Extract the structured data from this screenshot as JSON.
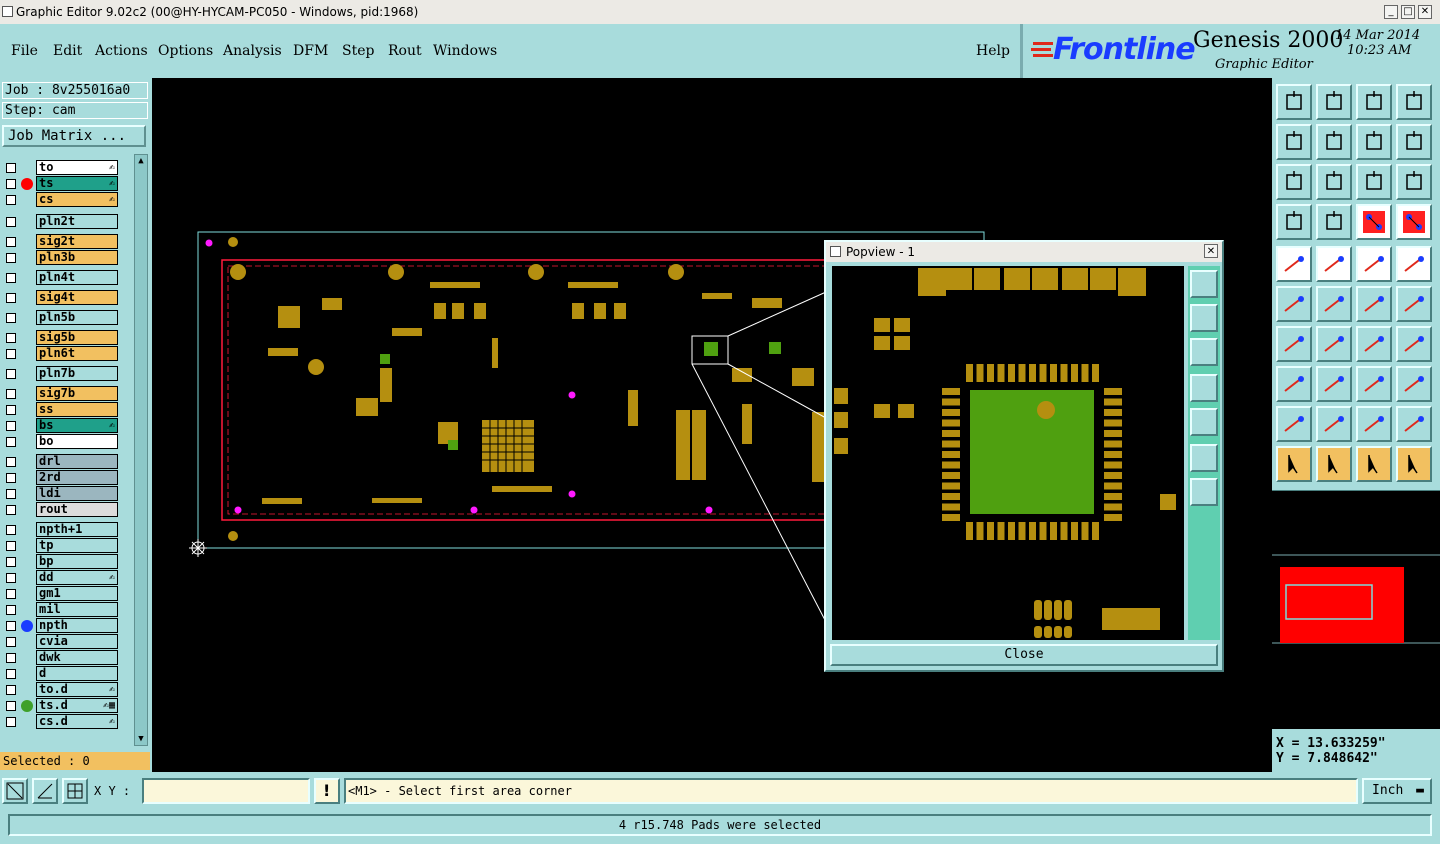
{
  "window": {
    "title": "Graphic Editor 9.02c2 (00@HY-HYCAM-PC050 - Windows, pid:1968)",
    "min_label": "_",
    "max_label": "□",
    "close_label": "✕"
  },
  "menu": {
    "items": [
      "File",
      "Edit",
      "Actions",
      "Options",
      "Analysis",
      "DFM",
      "Step",
      "Rout",
      "Windows"
    ],
    "help": "Help"
  },
  "logo": {
    "brand": "Frontline",
    "product": "Genesis 2000",
    "subtitle": "Graphic Editor",
    "date": "14 Mar 2014",
    "time": "10:23 AM"
  },
  "job": {
    "job_label": "Job : 8v255016a0",
    "step_label": "Step: cam",
    "matrix_button": "Job Matrix ..."
  },
  "layers": [
    {
      "name": "to",
      "color": "#ffffff",
      "dot": "",
      "mark": "✍"
    },
    {
      "name": "ts",
      "color": "#1fa08a",
      "dot": "#ff0000",
      "mark": "✍"
    },
    {
      "name": "cs",
      "color": "#f2c060",
      "dot": "",
      "mark": "✍"
    },
    {
      "name": "pln2t",
      "color": "#a8dcdc",
      "dot": "",
      "mark": ""
    },
    {
      "name": "sig2t",
      "color": "#f2c060",
      "dot": "",
      "mark": ""
    },
    {
      "name": "pln3b",
      "color": "#f2c060",
      "dot": "",
      "mark": ""
    },
    {
      "name": "pln4t",
      "color": "#a8dcdc",
      "dot": "",
      "mark": ""
    },
    {
      "name": "sig4t",
      "color": "#f2c060",
      "dot": "",
      "mark": ""
    },
    {
      "name": "pln5b",
      "color": "#a8dcdc",
      "dot": "",
      "mark": ""
    },
    {
      "name": "sig5b",
      "color": "#f2c060",
      "dot": "",
      "mark": ""
    },
    {
      "name": "pln6t",
      "color": "#f2c060",
      "dot": "",
      "mark": ""
    },
    {
      "name": "pln7b",
      "color": "#a8dcdc",
      "dot": "",
      "mark": ""
    },
    {
      "name": "sig7b",
      "color": "#f2c060",
      "dot": "",
      "mark": ""
    },
    {
      "name": "ss",
      "color": "#f2c060",
      "dot": "",
      "mark": ""
    },
    {
      "name": "bs",
      "color": "#1fa08a",
      "dot": "",
      "mark": "✍"
    },
    {
      "name": "bo",
      "color": "#ffffff",
      "dot": "",
      "mark": ""
    },
    {
      "name": "drl",
      "color": "#9bb6bf",
      "dot": "",
      "mark": ""
    },
    {
      "name": "2rd",
      "color": "#9bb6bf",
      "dot": "",
      "mark": ""
    },
    {
      "name": "ldi",
      "color": "#9bb6bf",
      "dot": "",
      "mark": ""
    },
    {
      "name": "rout",
      "color": "#dcdcdc",
      "dot": "",
      "mark": ""
    },
    {
      "name": "npth+1",
      "color": "#a8dcdc",
      "dot": "",
      "mark": ""
    },
    {
      "name": "tp",
      "color": "#a8dcdc",
      "dot": "",
      "mark": ""
    },
    {
      "name": "bp",
      "color": "#a8dcdc",
      "dot": "",
      "mark": ""
    },
    {
      "name": "dd",
      "color": "#a8dcdc",
      "dot": "",
      "mark": "✍"
    },
    {
      "name": "gm1",
      "color": "#a8dcdc",
      "dot": "",
      "mark": ""
    },
    {
      "name": "mil",
      "color": "#a8dcdc",
      "dot": "",
      "mark": ""
    },
    {
      "name": "npth",
      "color": "#a8dcdc",
      "dot": "#1a3cff",
      "mark": ""
    },
    {
      "name": "cvia",
      "color": "#a8dcdc",
      "dot": "",
      "mark": ""
    },
    {
      "name": "dwk",
      "color": "#a8dcdc",
      "dot": "",
      "mark": ""
    },
    {
      "name": "d",
      "color": "#a8dcdc",
      "dot": "",
      "mark": ""
    },
    {
      "name": "to.d",
      "color": "#a8dcdc",
      "dot": "",
      "mark": "✍"
    },
    {
      "name": "ts.d",
      "color": "#a8dcdc",
      "dot": "#3fa02a",
      "mark": "✍▦"
    },
    {
      "name": "cs.d",
      "color": "#a8dcdc",
      "dot": "",
      "mark": "✍"
    }
  ],
  "selected": "Selected : 0",
  "popview": {
    "title": "Popview - 1",
    "close_button": "Close"
  },
  "coords": {
    "x": "X = 13.633259\"",
    "y": "Y = 7.848642\""
  },
  "bottom": {
    "xy_label": "X Y :",
    "xy_value": "",
    "prompt": "<M1> - Select first area corner",
    "unit": "Inch",
    "status": "4 r15.748 Pads were selected"
  },
  "colors": {
    "panel": "#a8dcdc",
    "pad_gold": "#b58f10",
    "highlight_green": "#4fa010",
    "outline_red": "#ff1a3c",
    "selection_magenta": "#ff1aff",
    "profile_cyan": "#7fdcdc"
  }
}
